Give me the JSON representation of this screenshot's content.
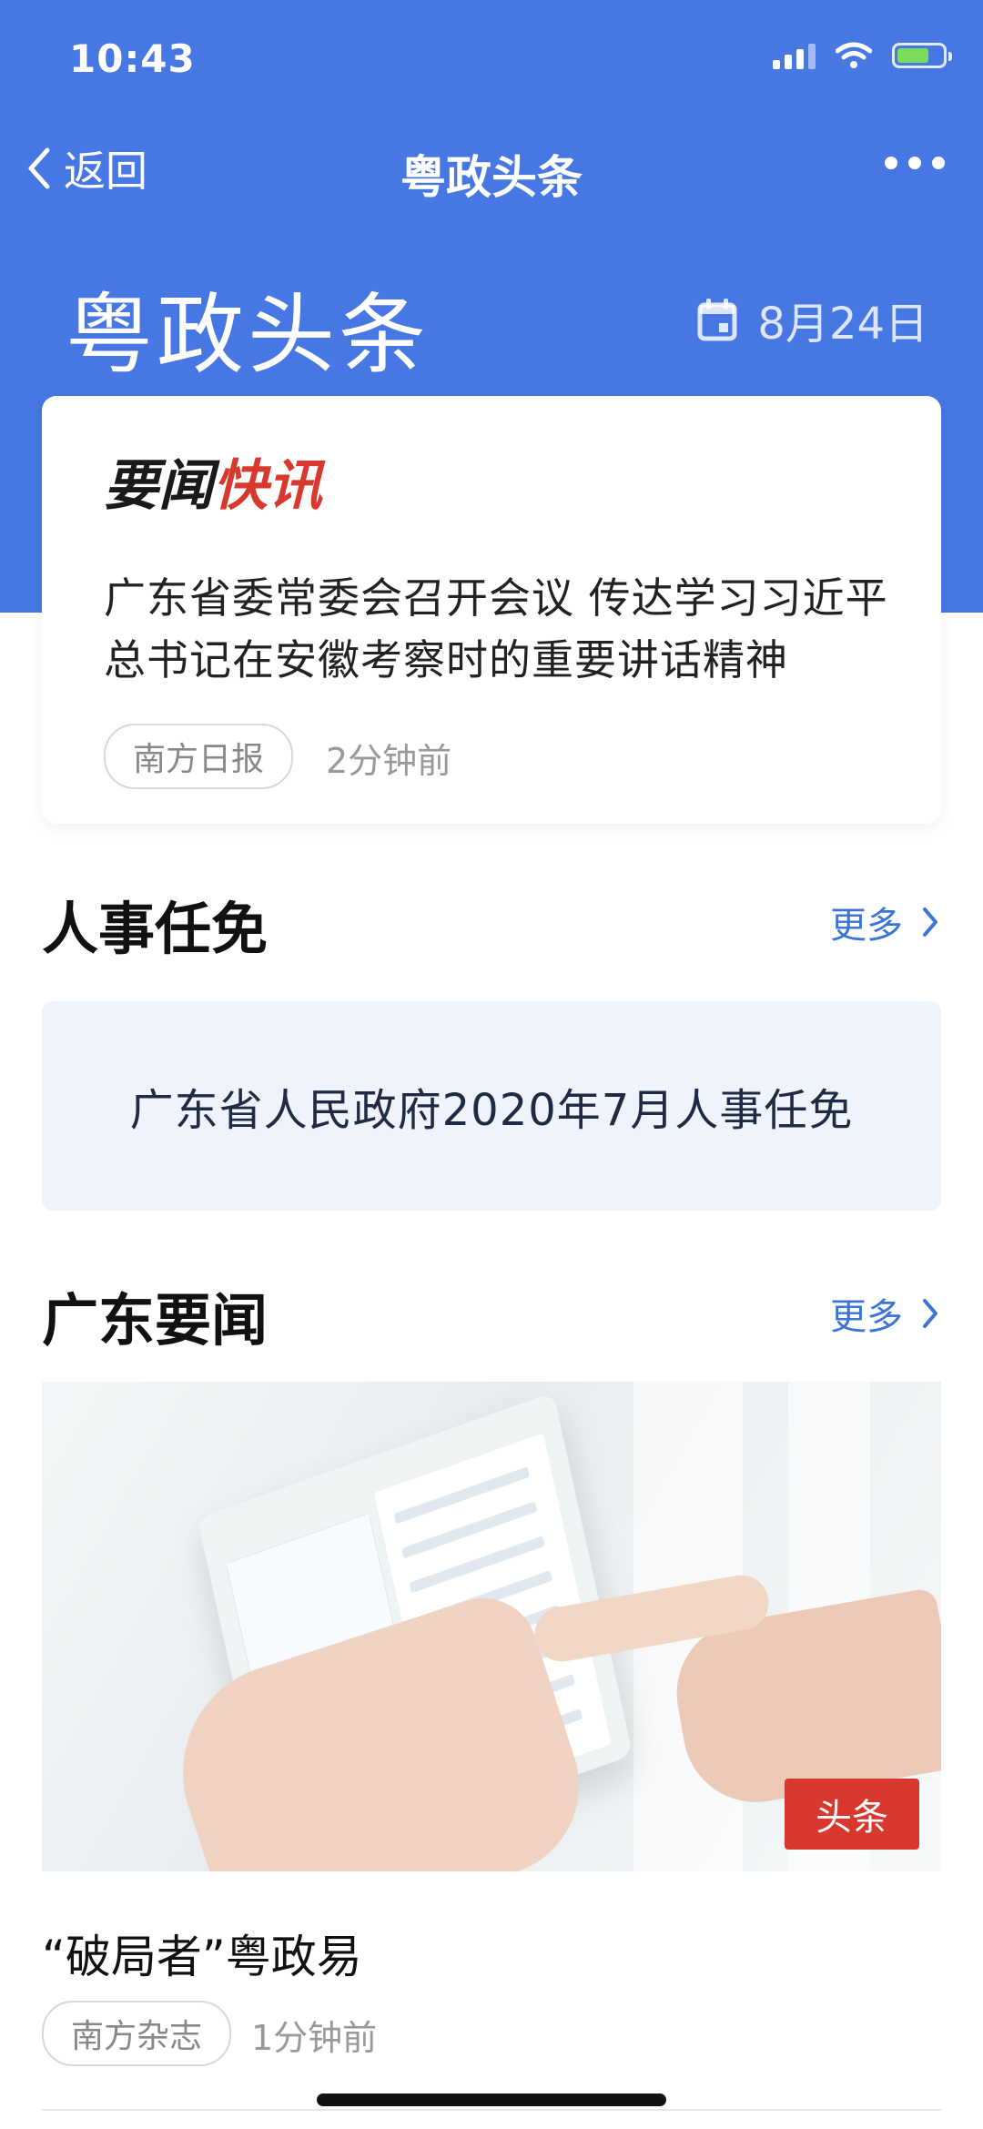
{
  "status_bar": {
    "time": "10:43"
  },
  "nav": {
    "back_label": "返回",
    "title": "粤政头条"
  },
  "hero": {
    "title": "粤政头条",
    "date": "8月24日"
  },
  "flash_news": {
    "heading_black": "要闻",
    "heading_red": "快讯",
    "headline": "广东省委常委会召开会议 传达学习习近平总书记在安徽考察时的重要讲话精神",
    "source": "南方日报",
    "time": "2分钟前"
  },
  "personnel": {
    "title": "人事任免",
    "more_label": "更多",
    "item": "广东省人民政府2020年7月人事任免"
  },
  "guangdong_news": {
    "title": "广东要闻",
    "more_label": "更多",
    "badge": "头条",
    "article_title": "“破局者”粤政易",
    "source": "南方杂志",
    "time": "1分钟前"
  },
  "colors": {
    "brand_blue": "#4677e2",
    "accent_red": "#d8382d",
    "link_blue": "#3d74d9"
  },
  "icons": [
    "signal-icon",
    "wifi-icon",
    "battery-icon",
    "back-chevron-icon",
    "more-dots-icon",
    "calendar-icon",
    "chevron-right-icon"
  ]
}
